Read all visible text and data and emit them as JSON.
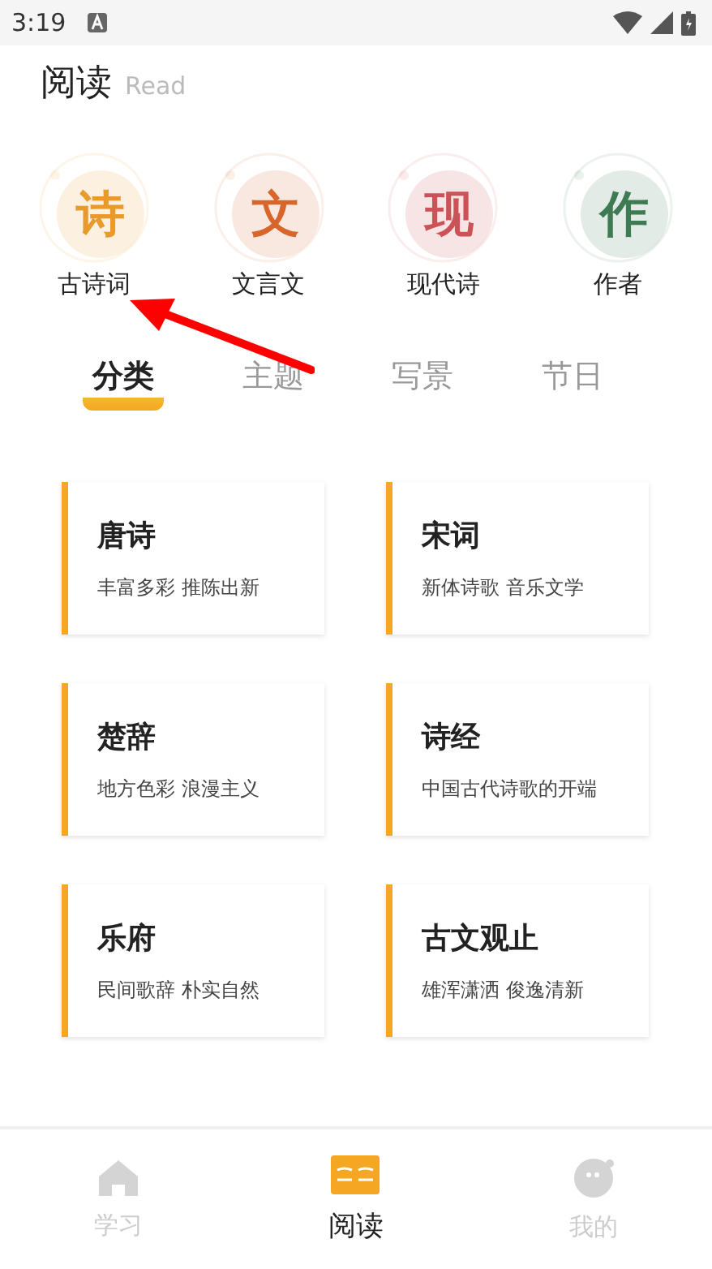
{
  "status_bar": {
    "time": "3:19"
  },
  "header": {
    "title": "阅读",
    "subtitle": "Read"
  },
  "categories": [
    {
      "glyph": "诗",
      "label": "古诗词",
      "color": "#e89a2c"
    },
    {
      "glyph": "文",
      "label": "文言文",
      "color": "#d8662a"
    },
    {
      "glyph": "现",
      "label": "现代诗",
      "color": "#cc5258"
    },
    {
      "glyph": "作",
      "label": "作者",
      "color": "#3e7a52"
    }
  ],
  "annotation": {
    "kind": "arrow"
  },
  "tabs": [
    {
      "label": "分类",
      "selected": true
    },
    {
      "label": "主题",
      "selected": false
    },
    {
      "label": "写景",
      "selected": false
    },
    {
      "label": "节日",
      "selected": false
    }
  ],
  "cards": [
    {
      "title": "唐诗",
      "subtitle": "丰富多彩 推陈出新"
    },
    {
      "title": "宋词",
      "subtitle": "新体诗歌 音乐文学"
    },
    {
      "title": "楚辞",
      "subtitle": "地方色彩 浪漫主义"
    },
    {
      "title": "诗经",
      "subtitle": "中国古代诗歌的开端"
    },
    {
      "title": "乐府",
      "subtitle": "民间歌辞 朴实自然"
    },
    {
      "title": "古文观止",
      "subtitle": "雄浑潇洒 俊逸清新"
    }
  ],
  "bottom_nav": [
    {
      "label": "学习",
      "kind": "home",
      "selected": false
    },
    {
      "label": "阅读",
      "kind": "book",
      "selected": true
    },
    {
      "label": "我的",
      "kind": "face",
      "selected": false
    }
  ]
}
